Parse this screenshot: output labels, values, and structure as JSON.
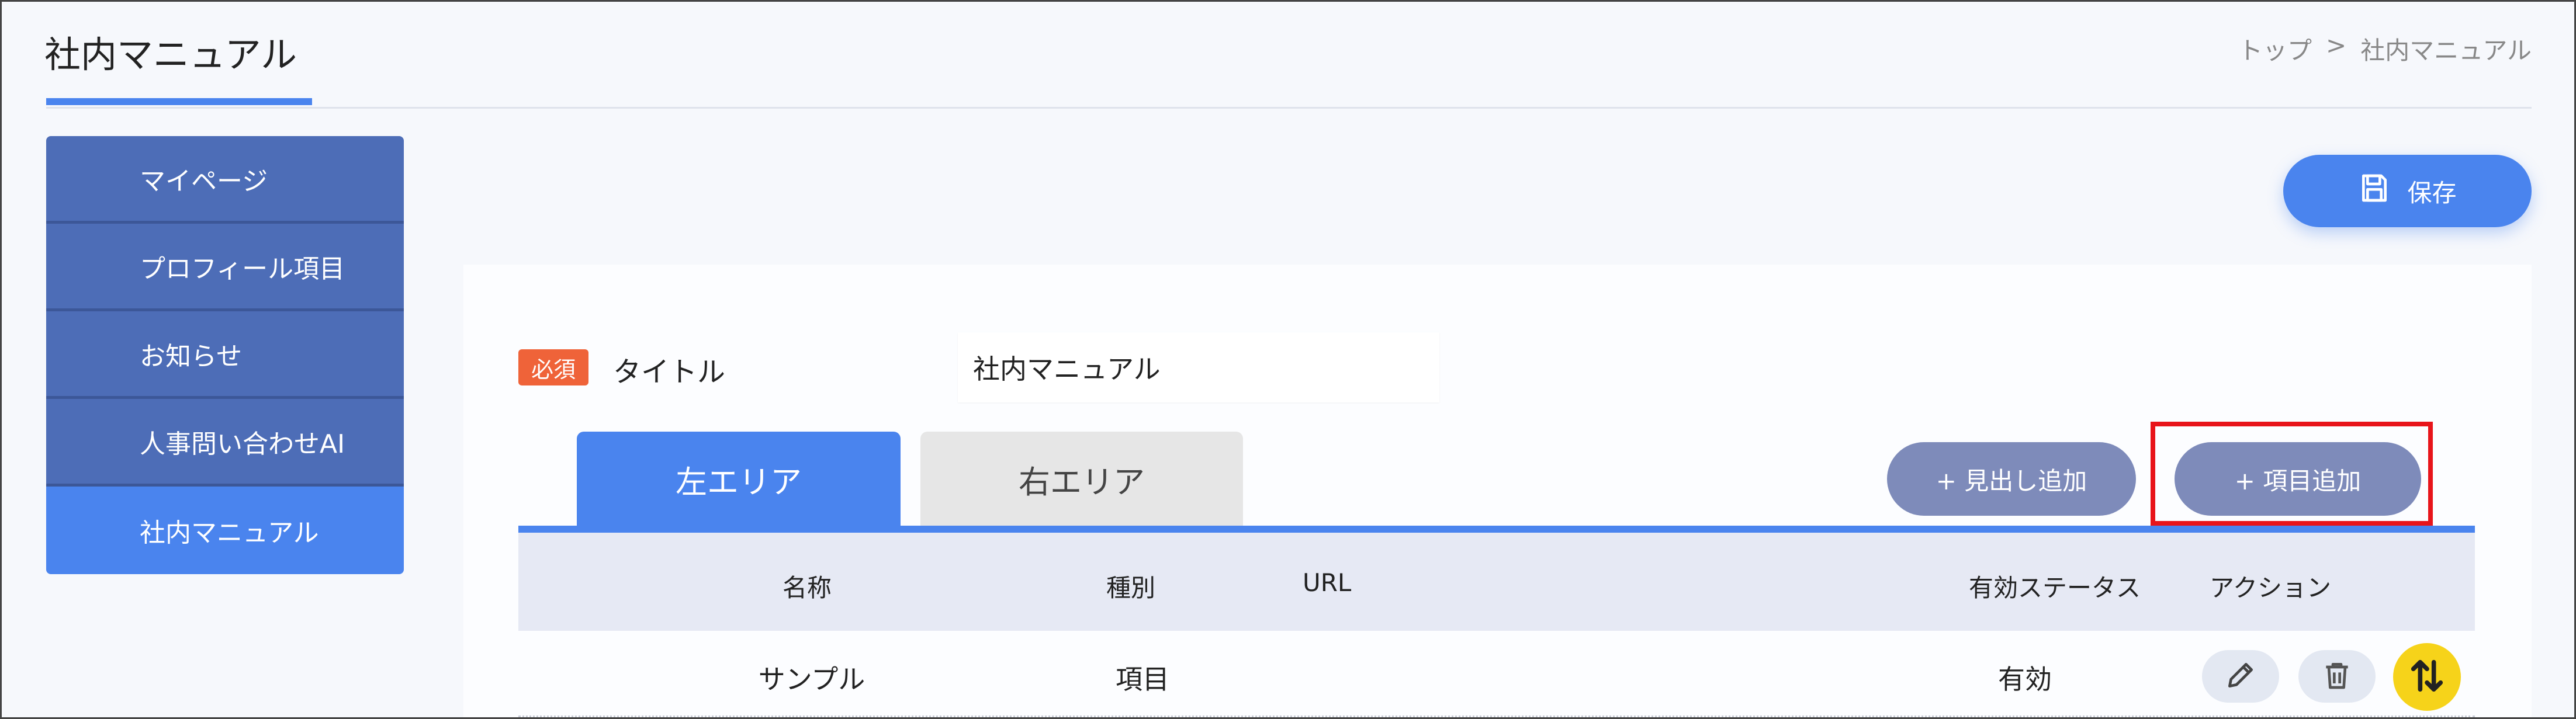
{
  "header": {
    "title": "社内マニュアル",
    "breadcrumb": {
      "home": "トップ",
      "separator": ">",
      "current": "社内マニュアル"
    }
  },
  "sidebar": {
    "items": [
      {
        "label": "マイページ"
      },
      {
        "label": "プロフィール項目"
      },
      {
        "label": "お知らせ"
      },
      {
        "label": "人事問い合わせAI"
      },
      {
        "label": "社内マニュアル",
        "active": true
      }
    ]
  },
  "toolbar": {
    "save_label": "保存",
    "save_icon": "floppy-disk-icon"
  },
  "form": {
    "required_badge": "必須",
    "title_label": "タイトル",
    "title_value": "社内マニュアル"
  },
  "tabs": [
    {
      "label": "左エリア",
      "active": true
    },
    {
      "label": "右エリア",
      "active": false
    }
  ],
  "buttons": {
    "add_heading": "+ 見出し追加",
    "add_item": "+ 項目追加"
  },
  "table": {
    "columns": [
      "名称",
      "種別",
      "URL",
      "有効ステータス",
      "アクション"
    ],
    "rows": [
      {
        "name": "サンプル",
        "type": "項目",
        "url": "",
        "status": "有効"
      }
    ]
  },
  "colors": {
    "accent": "#4a84ee",
    "sidebar": "#4d6db7",
    "pill": "#7e8bba",
    "required": "#ef6339",
    "highlight": "#e8141a",
    "sort_handle": "#f6d31a"
  }
}
